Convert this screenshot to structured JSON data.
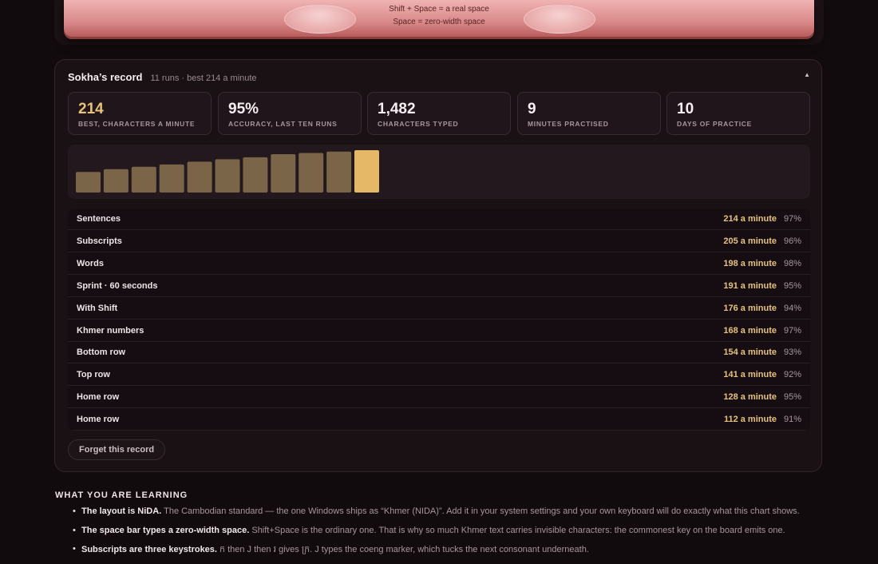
{
  "keyboard": {
    "legend_shift": "Shift + Space = a real space",
    "legend_plain": "Space = zero-width space"
  },
  "record": {
    "title": "Sokha’s record",
    "subtitle": "11 runs · best 214 a minute",
    "collapse_glyph": "▲",
    "stats": [
      {
        "value": "214",
        "label": "BEST, CHARACTERS A MINUTE"
      },
      {
        "value": "95%",
        "label": "ACCURACY, LAST TEN RUNS"
      },
      {
        "value": "1,482",
        "label": "CHARACTERS TYPED"
      },
      {
        "value": "9",
        "label": "MINUTES PRACTISED"
      },
      {
        "value": "10",
        "label": "DAYS OF PRACTICE"
      }
    ],
    "runs": [
      {
        "name": "Sentences",
        "rate": "214 a minute",
        "accuracy": "97%"
      },
      {
        "name": "Subscripts",
        "rate": "205 a minute",
        "accuracy": "96%"
      },
      {
        "name": "Words",
        "rate": "198 a minute",
        "accuracy": "98%"
      },
      {
        "name": "Sprint · 60 seconds",
        "rate": "191 a minute",
        "accuracy": "95%"
      },
      {
        "name": "With Shift",
        "rate": "176 a minute",
        "accuracy": "94%"
      },
      {
        "name": "Khmer numbers",
        "rate": "168 a minute",
        "accuracy": "97%"
      },
      {
        "name": "Bottom row",
        "rate": "154 a minute",
        "accuracy": "93%"
      },
      {
        "name": "Top row",
        "rate": "141 a minute",
        "accuracy": "92%"
      },
      {
        "name": "Home row",
        "rate": "128 a minute",
        "accuracy": "95%"
      },
      {
        "name": "Home row",
        "rate": "112 a minute",
        "accuracy": "91%"
      }
    ],
    "forget_label": "Forget this record"
  },
  "chart_data": {
    "type": "bar",
    "categories": [
      "1",
      "2",
      "3",
      "4",
      "5",
      "6",
      "7",
      "8",
      "9",
      "10",
      "11"
    ],
    "values": [
      104,
      118,
      130,
      142,
      156,
      168,
      178,
      194,
      200,
      207,
      214
    ],
    "ylim": [
      0,
      214
    ],
    "grid": false,
    "colors": {
      "bar": "#7a6548",
      "latest": "#e4b866"
    }
  },
  "learning": {
    "title": "WHAT YOU ARE LEARNING",
    "items": [
      {
        "lead": "The layout is NiDA.",
        "text": " The Cambodian standard — the one Windows ships as “Khmer (NIDA)”. Add it in your system settings and your own keyboard will do exactly what this chart shows."
      },
      {
        "lead": "The space bar types a zero-width space.",
        "text": " Shift+Space is the ordinary one. That is why so much Khmer text carries invisible characters: the commonest key on the board emits one."
      },
      {
        "lead": "Subscripts are three keystrokes.",
        "text": " ក then J then រ gives ក្រ. J types the coeng marker, which tucks the next consonant underneath."
      }
    ]
  }
}
